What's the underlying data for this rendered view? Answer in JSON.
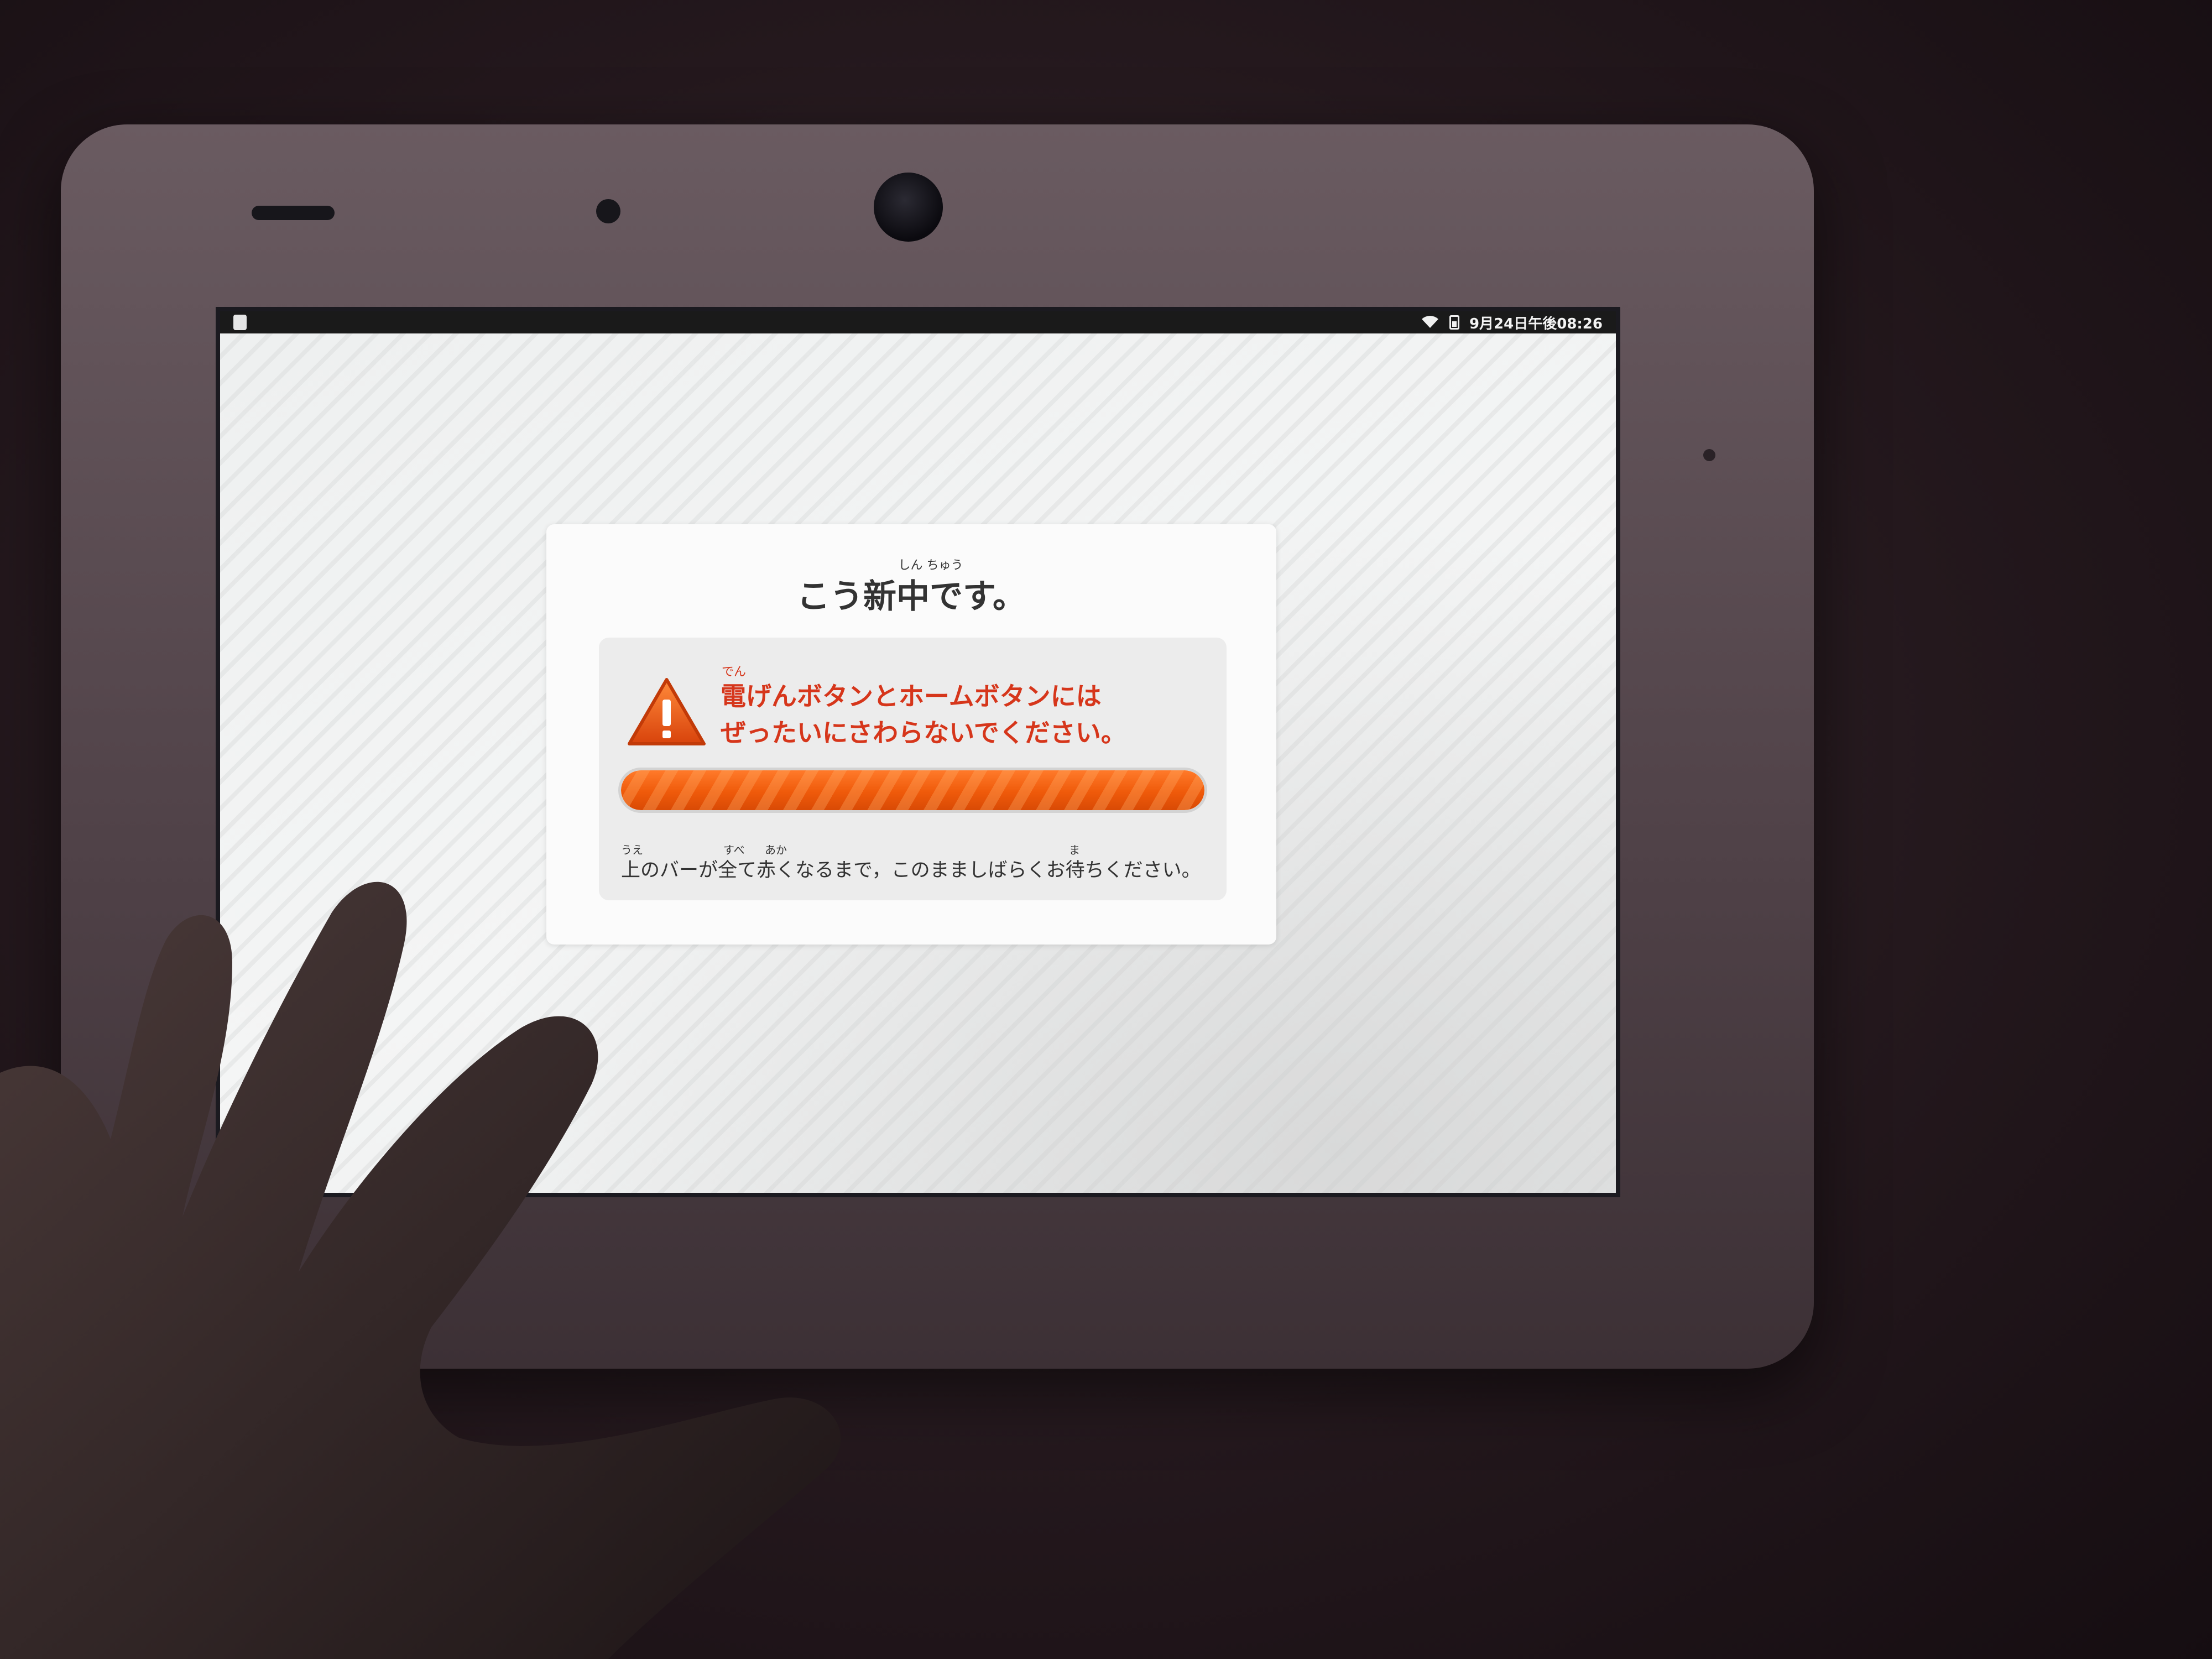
{
  "status_bar": {
    "clock": "9月24日午後08:26",
    "icons": [
      "home-indicator",
      "wifi-icon",
      "battery-icon"
    ]
  },
  "dialog": {
    "title": "こう新中です。",
    "title_ruby": "しん ちゅう",
    "warning": {
      "icon": "warning-triangle-icon",
      "ruby": "でん",
      "line1": "電げんボタンとホームボタンには",
      "line2": "ぜったいにさわらないでください。"
    },
    "progress": {
      "value": 1.0
    },
    "instruction": {
      "text": "上のバーが全て赤くなるまで，このまましばらくお待ちください。",
      "ruby_ue": "うえ",
      "ruby_subete": "すべ",
      "ruby_aka": "あか",
      "ruby_ma": "ま"
    }
  },
  "colors": {
    "warning_text": "#d6361b",
    "progress": "#ef5a0a",
    "screen_bg": "#eef0f0"
  }
}
